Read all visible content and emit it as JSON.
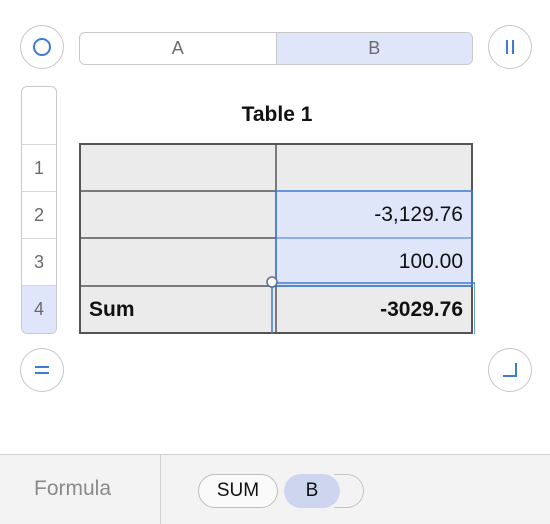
{
  "column_header": {
    "cells": [
      "A",
      "B"
    ],
    "selected": "B"
  },
  "row_header": {
    "rows": [
      "",
      "1",
      "2",
      "3",
      "4"
    ],
    "selected": "4"
  },
  "table": {
    "title": "Table 1",
    "rows": [
      [
        "",
        ""
      ],
      [
        "",
        "-3,129.76"
      ],
      [
        "",
        "100.00"
      ],
      [
        "Sum",
        "-3029.76"
      ]
    ]
  },
  "formula_bar": {
    "label": "Formula",
    "function_token": "SUM",
    "reference_token": "B"
  },
  "icons": {
    "top_left": "circle-select-icon",
    "top_right": "pause-bars-icon",
    "bottom_left": "equals-icon",
    "bottom_right": "corner-resize-icon"
  },
  "colors": {
    "accent": "#3d7bd6",
    "selection_fill": "#dfe6fa",
    "cell_fill": "#ebebeb",
    "grid_line": "#555555"
  }
}
